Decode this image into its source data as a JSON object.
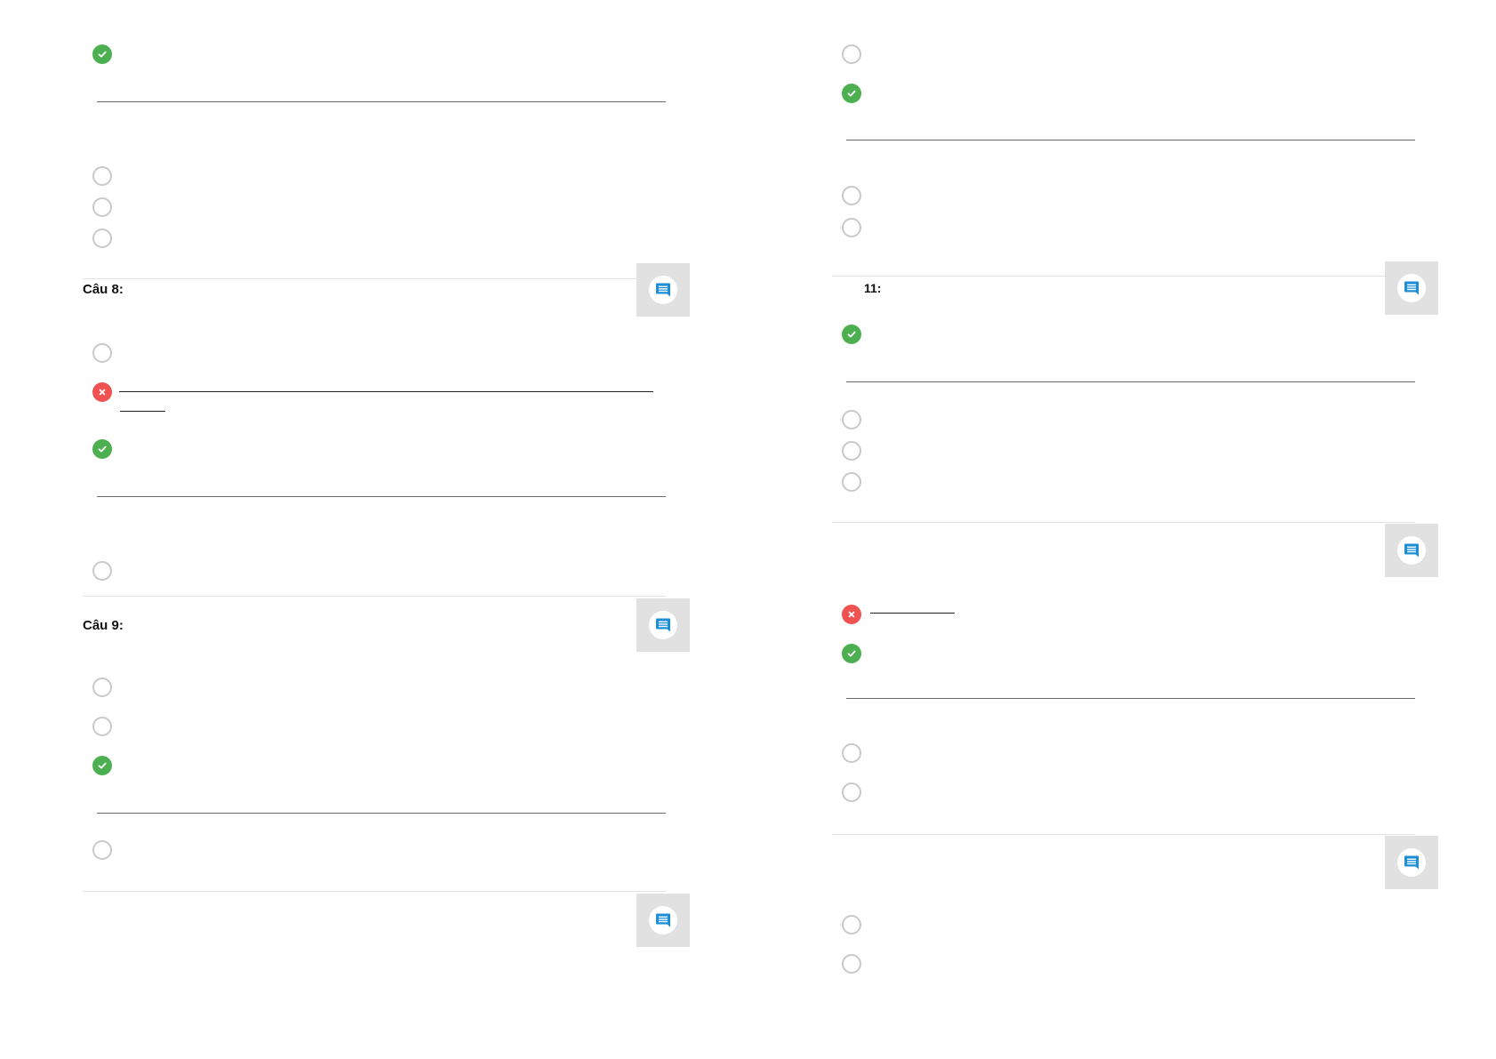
{
  "questions": [
    {
      "label": "Câu 8:"
    },
    {
      "label": "Câu 9:"
    },
    {
      "label": "11:"
    }
  ],
  "icons": {
    "correct": "check-circle-icon",
    "wrong": "x-circle-icon",
    "unselected": "radio-empty-icon",
    "comment": "comment-icon"
  },
  "colors": {
    "correct": "#4caf50",
    "wrong": "#f05252",
    "comment_accent": "#1e8fd6",
    "comment_box": "#e1e1e1"
  }
}
